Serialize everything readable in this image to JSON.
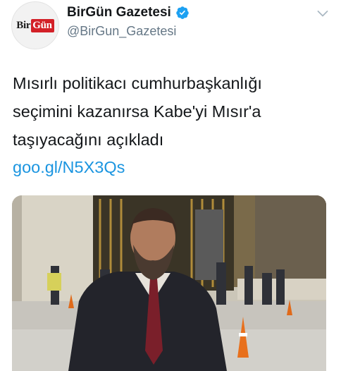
{
  "account": {
    "avatar_logo_part1": "Bir",
    "avatar_logo_part2": "Gün",
    "display_name": "BirGün Gazetesi",
    "handle": "@BirGun_Gazetesi",
    "verified": true
  },
  "tweet": {
    "text_lines": [
      "Mısırlı politikacı cumhurbaşkanlığı",
      "seçimini kazanırsa Kabe'yi Mısır'a",
      "taşıyacağını açıkladı"
    ],
    "link": "goo.gl/N5X3Qs"
  },
  "colors": {
    "link": "#1b95e0",
    "verified_badge": "#1da1f2",
    "handle": "#657786",
    "logo_red": "#d32027"
  },
  "icons": {
    "verified": "verified-badge-icon",
    "menu": "chevron-down-icon"
  }
}
